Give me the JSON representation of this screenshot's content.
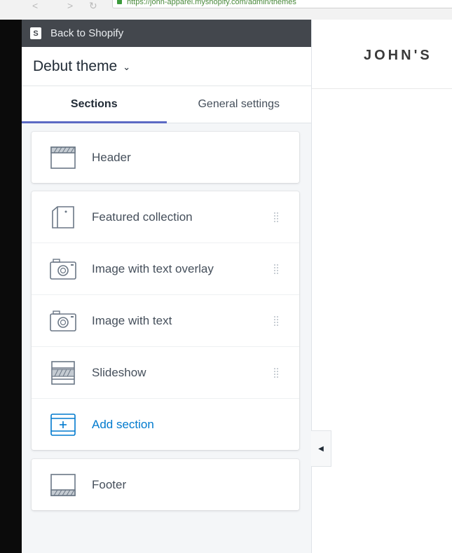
{
  "browser": {
    "url": "https://john-apparel.myshopify.com/admin/themes"
  },
  "editor": {
    "back_label": "Back to Shopify",
    "theme_name": "Debut theme",
    "tabs": [
      {
        "label": "Sections",
        "active": true
      },
      {
        "label": "General settings",
        "active": false
      }
    ],
    "header_section": {
      "label": "Header",
      "icon": "header-layout-icon"
    },
    "sections": [
      {
        "label": "Featured collection",
        "icon": "collection-icon"
      },
      {
        "label": "Image with text overlay",
        "icon": "camera-icon"
      },
      {
        "label": "Image with text",
        "icon": "camera-icon"
      },
      {
        "label": "Slideshow",
        "icon": "slideshow-icon"
      }
    ],
    "add_section_label": "Add section",
    "footer_section": {
      "label": "Footer",
      "icon": "footer-layout-icon"
    }
  },
  "preview": {
    "store_name": "JOHN'S"
  },
  "colors": {
    "accent": "#5c6ac4",
    "link": "#007ace",
    "topbar": "#43474d"
  }
}
